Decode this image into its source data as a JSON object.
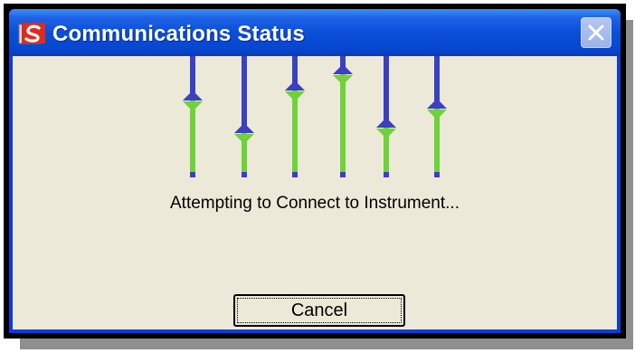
{
  "window": {
    "title": "Communications Status",
    "icon": "app-s-logo-icon"
  },
  "titlebar": {
    "close_icon": "close-icon"
  },
  "activity_indicator": {
    "levels": [
      0.62,
      0.31,
      0.72,
      0.88,
      0.36,
      0.54
    ],
    "colors": {
      "upper": "#3b3fc4",
      "lower": "#6fd23a",
      "diamond_top": "#3b3fc4",
      "diamond_bottom": "#6fd23a"
    }
  },
  "status": {
    "message": "Attempting to Connect to Instrument..."
  },
  "buttons": {
    "cancel_label": "Cancel"
  },
  "colors": {
    "titlebar": "#0a4fd8",
    "client_background": "#ece9d8"
  }
}
